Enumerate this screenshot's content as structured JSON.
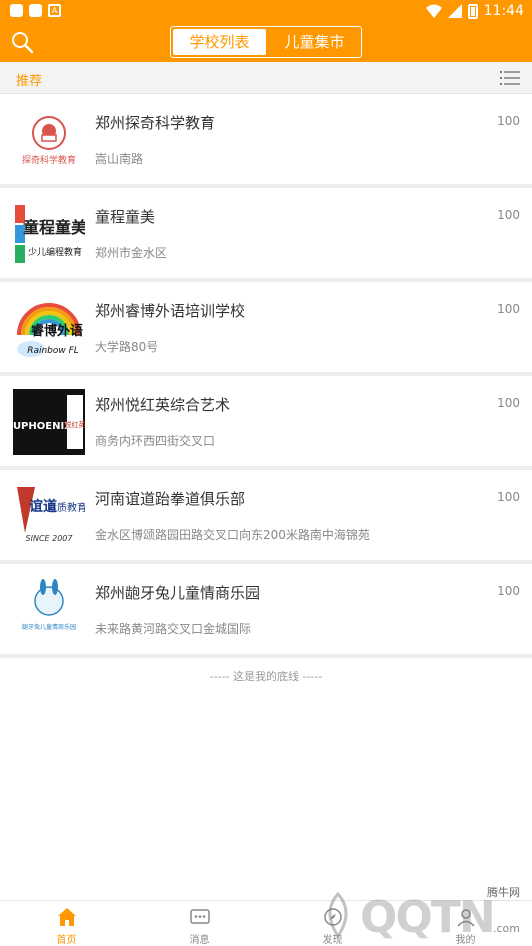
{
  "status": {
    "time": "11:44"
  },
  "header": {
    "tab_active": "学校列表",
    "tab_other": "儿童集市"
  },
  "section": {
    "title": "推荐"
  },
  "schools": [
    {
      "name": "郑州探奇科学教育",
      "address": "嵩山南路",
      "score": "100"
    },
    {
      "name": "童程童美",
      "address": "郑州市金水区",
      "score": "100"
    },
    {
      "name": "郑州睿博外语培训学校",
      "address": "大学路80号",
      "score": "100"
    },
    {
      "name": "郑州悦红英综合艺术",
      "address": "商务内环西四街交叉口",
      "score": "100"
    },
    {
      "name": "河南谊道跆拳道俱乐部",
      "address": "金水区博颂路园田路交叉口向东200米路南中海锦苑",
      "score": "100"
    },
    {
      "name": "郑州龅牙兔儿童情商乐园",
      "address": "未来路黄河路交叉口金城国际",
      "score": "100"
    }
  ],
  "logos": {
    "l1": "探奇科学教育",
    "l2a": "童程童美",
    "l2b": "少儿编程教育",
    "l3a": "睿博外语",
    "l3b": "Rainbow FL",
    "l4a": "EUPHOENIX",
    "l4b": "悦红英",
    "l5a": "谊道",
    "l5b": "素质教育",
    "l5c": "SINCE 2007",
    "l6": "龅牙兔儿童情商乐园"
  },
  "footer_line": "----- 这是我的底线 -----",
  "tabs": [
    {
      "label": "首页"
    },
    {
      "label": "消息"
    },
    {
      "label": "发现"
    },
    {
      "label": "我的"
    }
  ],
  "watermark": {
    "brand": "QQTN",
    "site": "腾牛网",
    "domain": ".com"
  },
  "colors": {
    "accent": "#FF9800"
  }
}
